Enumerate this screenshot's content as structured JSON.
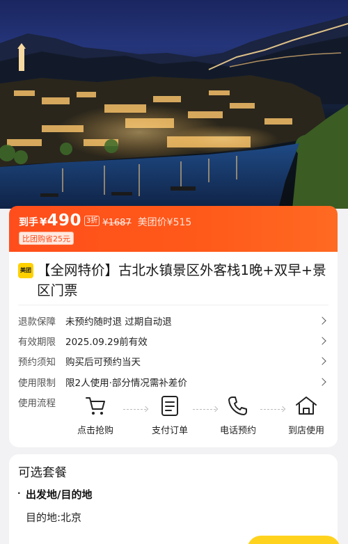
{
  "hero": {
    "icon": "scenic-photo"
  },
  "price": {
    "prefix": "到手",
    "currency": "¥",
    "amount": "490",
    "discount": "3折",
    "original": "¥1687",
    "meituan_price": "美团价¥515",
    "save_tag": "比团购省25元"
  },
  "product": {
    "badge": "美团",
    "title": "【全网特价】古北水镇景区外客栈1晚+双早+景区门票"
  },
  "details": [
    {
      "label": "退款保障",
      "value": "未预约随时退 过期自动退"
    },
    {
      "label": "有效期限",
      "value": "2025.09.29前有效"
    },
    {
      "label": "预约须知",
      "value": "购买后可预约当天"
    },
    {
      "label": "使用限制",
      "value": "限2人使用·部分情况需补差价"
    }
  ],
  "flow": {
    "label": "使用流程",
    "steps": [
      {
        "icon": "cart-icon",
        "label": "点击抢购"
      },
      {
        "icon": "order-icon",
        "label": "支付订单"
      },
      {
        "icon": "phone-icon",
        "label": "电话预约"
      },
      {
        "icon": "home-icon",
        "label": "到店使用"
      }
    ]
  },
  "package": {
    "title": "可选套餐",
    "subtitle": "出发地/目的地",
    "destination": "目的地:北京"
  },
  "colors": {
    "brand_orange": "#ff5a1a",
    "meituan_yellow": "#ffd100"
  }
}
